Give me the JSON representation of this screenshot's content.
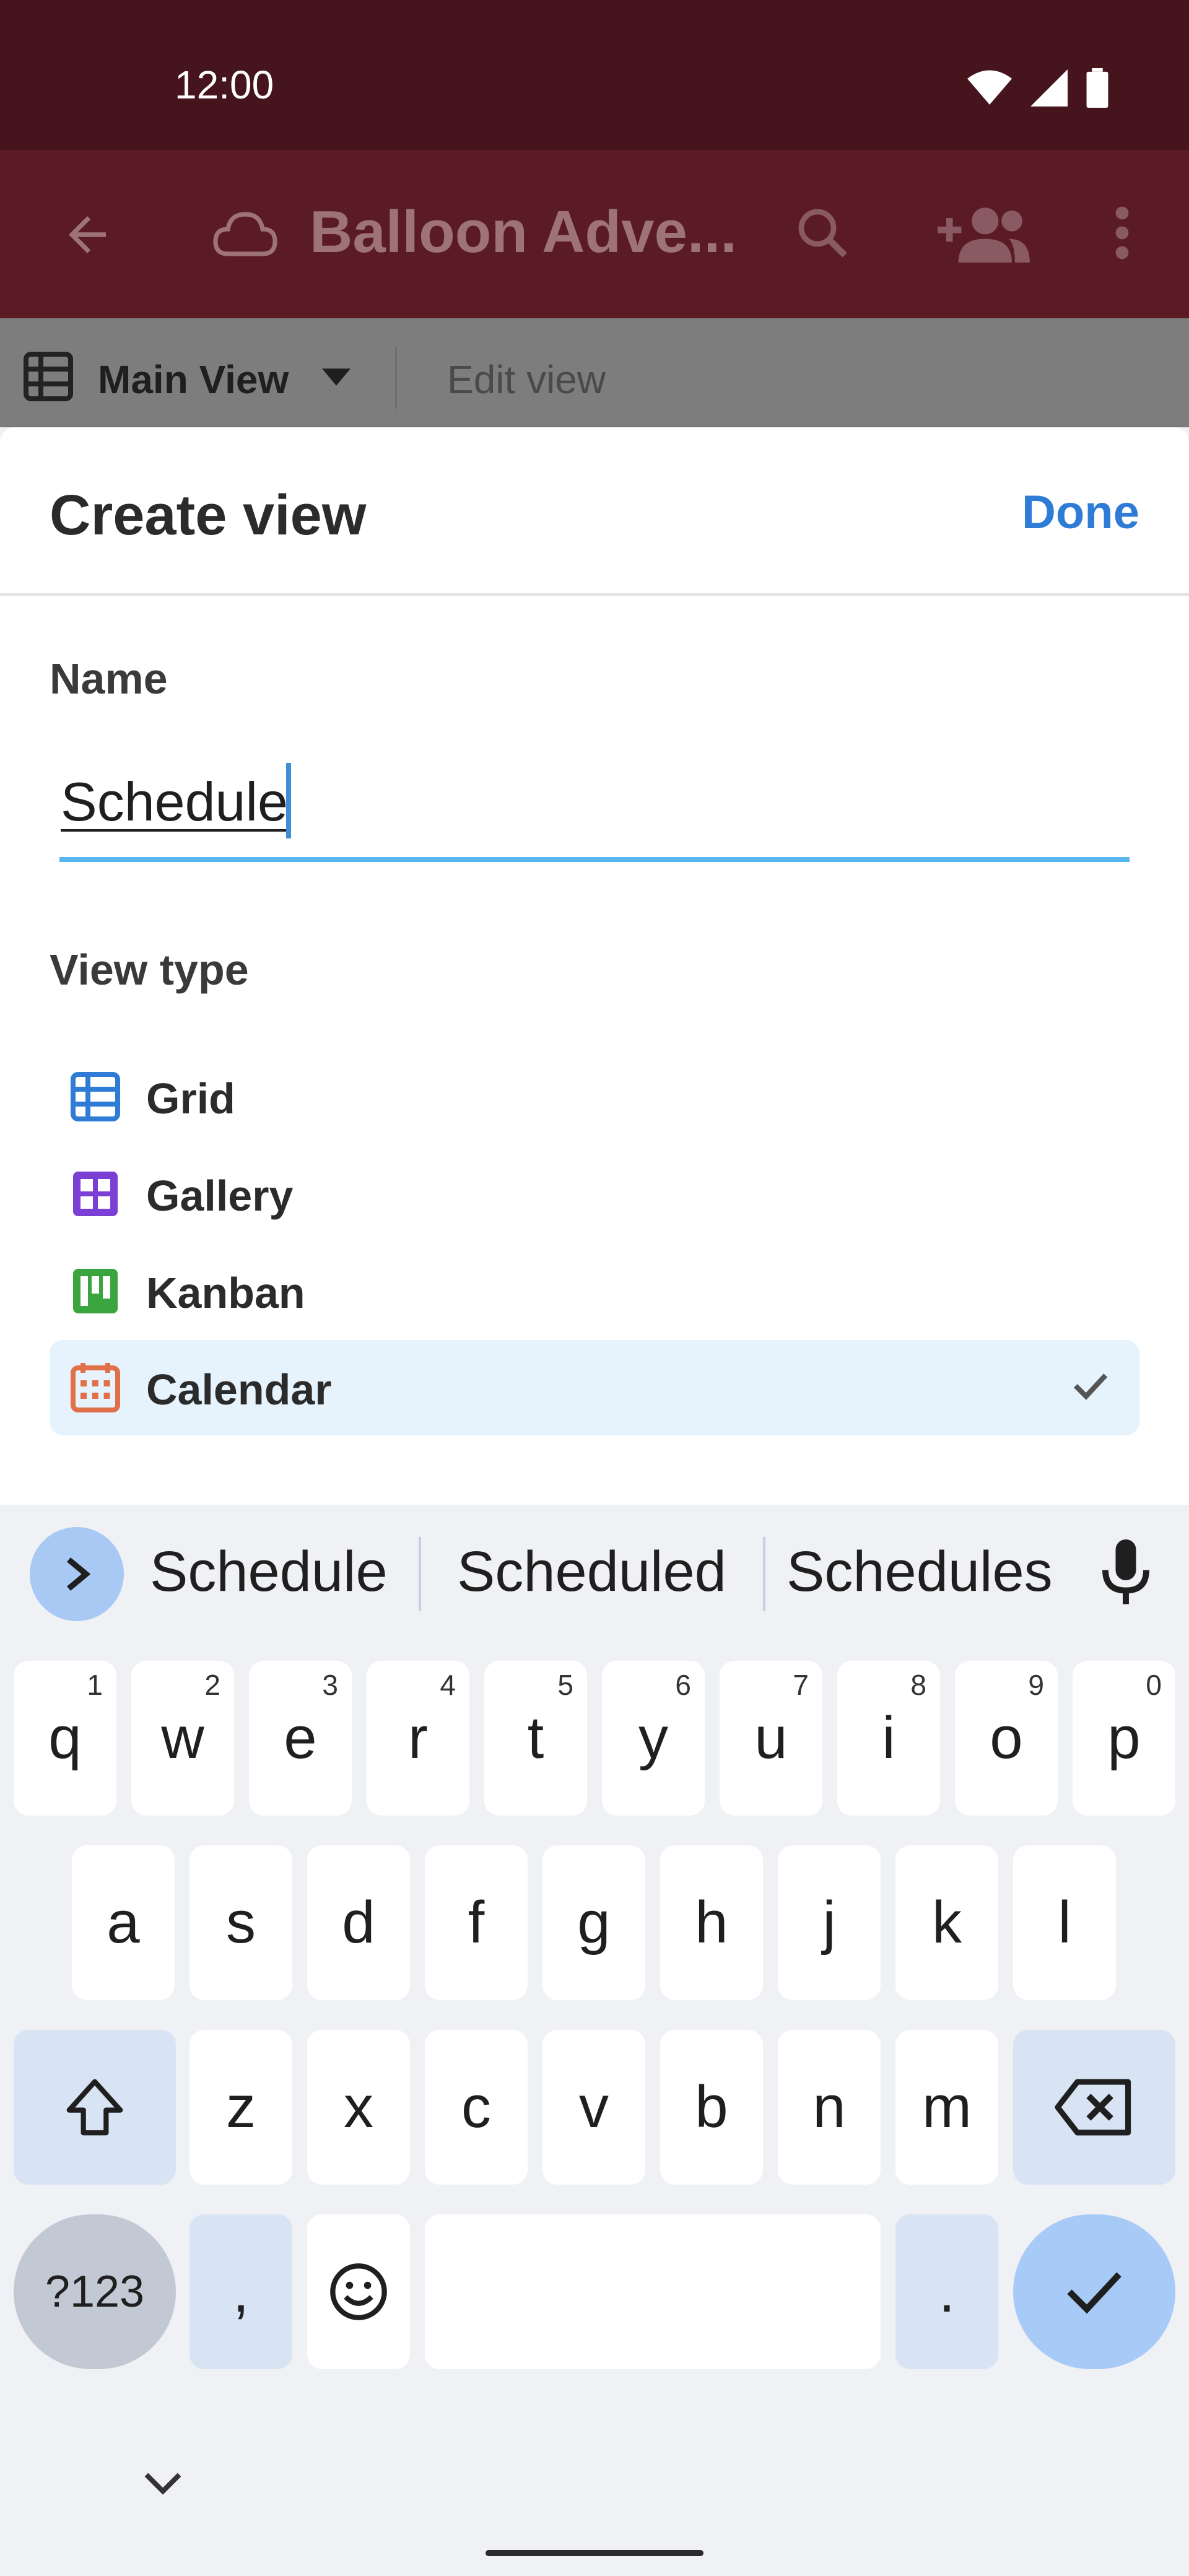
{
  "status_bar": {
    "time": "12:00"
  },
  "app_bar": {
    "title": "Balloon Adve..."
  },
  "view_bar": {
    "main_view_label": "Main View",
    "edit_view_label": "Edit view"
  },
  "sheet": {
    "title": "Create view",
    "done_label": "Done",
    "name_label": "Name",
    "name_value": "Schedule",
    "view_type_label": "View type",
    "view_types": [
      {
        "label": "Grid",
        "icon": "grid-icon",
        "color": "#2e7cd6",
        "selected": false
      },
      {
        "label": "Gallery",
        "icon": "gallery-icon",
        "color": "#7b3fd6",
        "selected": false
      },
      {
        "label": "Kanban",
        "icon": "kanban-icon",
        "color": "#3aa53e",
        "selected": false
      },
      {
        "label": "Calendar",
        "icon": "calendar-icon",
        "color": "#e0704a",
        "selected": true
      }
    ]
  },
  "keyboard": {
    "suggestions": [
      "Schedule",
      "Scheduled",
      "Schedules"
    ],
    "row1": [
      {
        "key": "q",
        "hint": "1"
      },
      {
        "key": "w",
        "hint": "2"
      },
      {
        "key": "e",
        "hint": "3"
      },
      {
        "key": "r",
        "hint": "4"
      },
      {
        "key": "t",
        "hint": "5"
      },
      {
        "key": "y",
        "hint": "6"
      },
      {
        "key": "u",
        "hint": "7"
      },
      {
        "key": "i",
        "hint": "8"
      },
      {
        "key": "o",
        "hint": "9"
      },
      {
        "key": "p",
        "hint": "0"
      }
    ],
    "row2": [
      "a",
      "s",
      "d",
      "f",
      "g",
      "h",
      "j",
      "k",
      "l"
    ],
    "row3": [
      "z",
      "x",
      "c",
      "v",
      "b",
      "n",
      "m"
    ],
    "symbols_label": "?123",
    "comma_label": ",",
    "period_label": "."
  },
  "colors": {
    "status_bar": "#45141c",
    "app_bar_dimmed": "#5b1b24",
    "accent_blue": "#2e7cd6",
    "input_underline": "#56b6ef",
    "selected_row": "#e6f3fc"
  }
}
